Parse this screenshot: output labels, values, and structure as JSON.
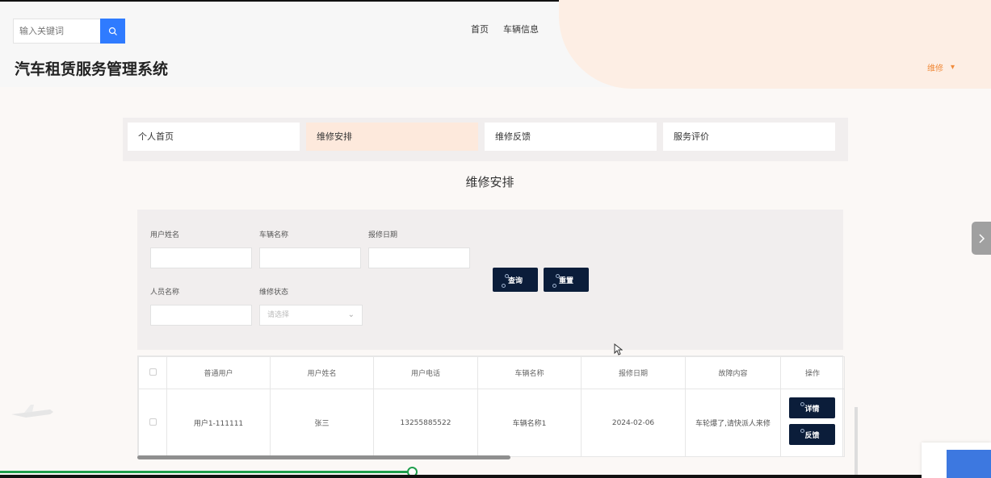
{
  "search": {
    "placeholder": "输入关键词"
  },
  "topnav": [
    {
      "label": "首页"
    },
    {
      "label": "车辆信息"
    }
  ],
  "site_title": "汽车租赁服务管理系统",
  "user_menu": {
    "label": "维修",
    "chevron": "▾"
  },
  "tabs": [
    {
      "label": "个人首页",
      "active": false
    },
    {
      "label": "维修安排",
      "active": true
    },
    {
      "label": "维修反馈",
      "active": false
    },
    {
      "label": "服务评价",
      "active": false
    }
  ],
  "page_heading": "维修安排",
  "filters": {
    "user_name_label": "用户姓名",
    "vehicle_name_label": "车辆名称",
    "report_date_label": "报修日期",
    "staff_name_label": "人员名称",
    "repair_status_label": "维修状态",
    "repair_status_placeholder": "请选择",
    "query_button": "查询",
    "reset_button": "重置"
  },
  "table": {
    "columns": [
      "普通用户",
      "用户姓名",
      "用户电话",
      "车辆名称",
      "报修日期",
      "故障内容",
      "操作"
    ],
    "rows": [
      {
        "user": "用户1-111111",
        "name": "张三",
        "phone": "13255885522",
        "vehicle": "车辆名称1",
        "date": "2024-02-06",
        "fault": "车轮爆了,请快派人来修",
        "actions": [
          "详情",
          "反馈"
        ]
      }
    ]
  },
  "colors": {
    "accent": "#2f7bff",
    "dark_button": "#0b1d3a",
    "active_tab": "#fde9dc",
    "user_menu": "#f08a3a"
  },
  "icons": {
    "search": "search-icon",
    "side_arrow": "chevron-right-icon",
    "cursor": "mouse-cursor-icon"
  }
}
